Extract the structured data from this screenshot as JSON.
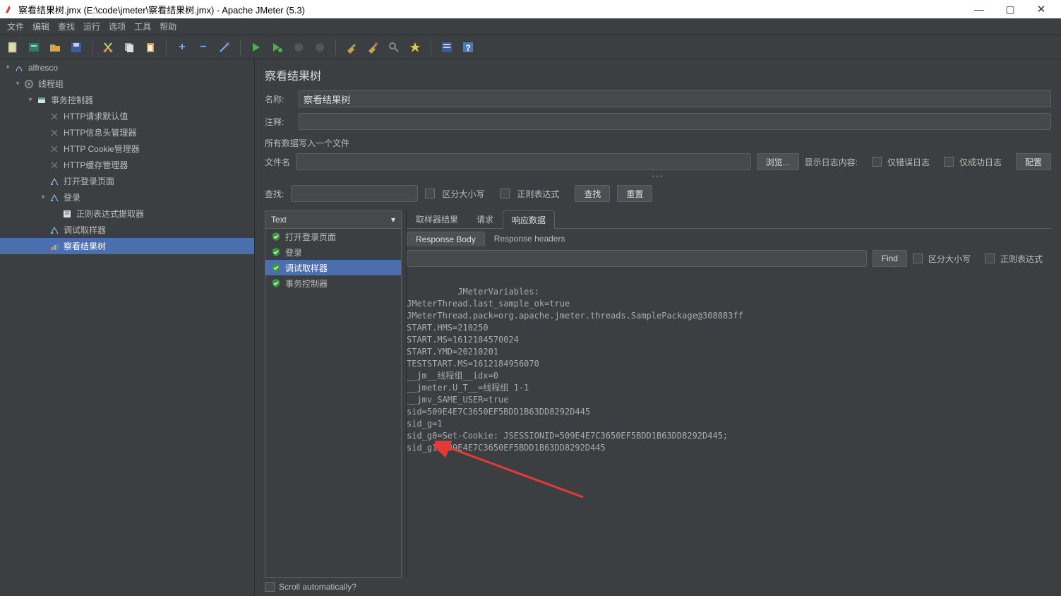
{
  "window": {
    "title": "察看结果树.jmx (E:\\code\\jmeter\\察看结果树.jmx) - Apache JMeter (5.3)",
    "min": "—",
    "max": "▢",
    "close": "✕"
  },
  "menu": [
    "文件",
    "编辑",
    "查找",
    "运行",
    "选项",
    "工具",
    "帮助"
  ],
  "tree": {
    "root": "alfresco",
    "thread": "线程组",
    "txn": "事务控制器",
    "items": [
      "HTTP请求默认值",
      "HTTP信息头管理器",
      "HTTP Cookie管理器",
      "HTTP缓存管理器",
      "打开登录页面"
    ],
    "login": "登录",
    "regex": "正则表达式提取器",
    "debug": "调试取样器",
    "view": "察看结果树"
  },
  "panel": {
    "title": "察看结果树",
    "name_label": "名称:",
    "name_value": "察看结果树",
    "comment_label": "注释:",
    "file_section": "所有数据写入一个文件",
    "filename_label": "文件名",
    "browse": "浏览...",
    "show_log_label": "显示日志内容:",
    "only_error": "仅错误日志",
    "only_success": "仅成功日志",
    "configure": "配置",
    "search_label": "查找:",
    "case_sens": "区分大小写",
    "regex_opt": "正则表达式",
    "find_btn": "查找",
    "reset_btn": "重置",
    "renderer": "Text",
    "results": [
      "打开登录页面",
      "登录",
      "调试取样器",
      "事务控制器"
    ],
    "tabs": {
      "sampler": "取样器结果",
      "request": "请求",
      "response": "响应数据"
    },
    "subtabs": {
      "body": "Response Body",
      "headers": "Response headers"
    },
    "find2": "Find",
    "case2": "区分大小写",
    "regex2": "正则表达式",
    "body": "JMeterVariables:\nJMeterThread.last_sample_ok=true\nJMeterThread.pack=org.apache.jmeter.threads.SamplePackage@308083ff\nSTART.HMS=210250\nSTART.MS=1612184570024\nSTART.YMD=20210201\nTESTSTART.MS=1612184956070\n__jm__线程组__idx=0\n__jmeter.U_T__=线程组 1-1\n__jmv_SAME_USER=true\nsid=509E4E7C3650EF5BDD1B63DD8292D445\nsid_g=1\nsid_g0=Set-Cookie: JSESSIONID=509E4E7C3650EF5BDD1B63DD8292D445;\nsid_g1=509E4E7C3650EF5BDD1B63DD8292D445",
    "scroll_auto": "Scroll automatically?"
  }
}
